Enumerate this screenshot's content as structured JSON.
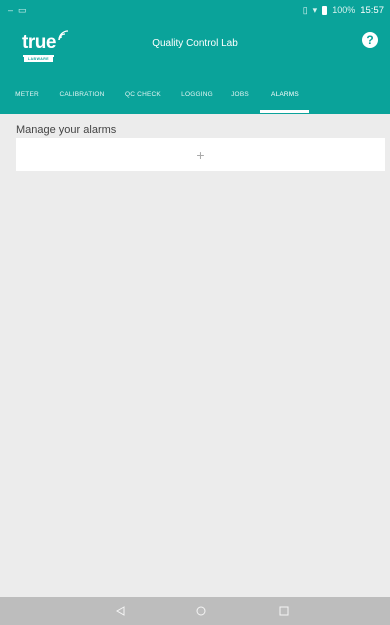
{
  "status_bar": {
    "battery_percent": "100%",
    "time": "15:57"
  },
  "toolbar": {
    "logo_text": "true",
    "logo_subtext": "LABWARE",
    "title": "Quality Control Lab",
    "help_label": "?"
  },
  "tabs": [
    {
      "label": "METER",
      "active": false
    },
    {
      "label": "CALIBRATION",
      "active": false
    },
    {
      "label": "QC CHECK",
      "active": false
    },
    {
      "label": "LOGGING",
      "active": false
    },
    {
      "label": "JOBS",
      "active": false
    },
    {
      "label": "ALARMS",
      "active": true
    }
  ],
  "content": {
    "section_title": "Manage your alarms",
    "add_label": "+"
  },
  "colors": {
    "accent": "#0aa39a",
    "background": "#ececec",
    "nav_bar": "#bdbdbd"
  },
  "icons": {
    "nav_back": "back-triangle-icon",
    "nav_home": "home-circle-icon",
    "nav_recents": "recents-square-icon",
    "help": "help-icon",
    "add": "plus-icon"
  }
}
